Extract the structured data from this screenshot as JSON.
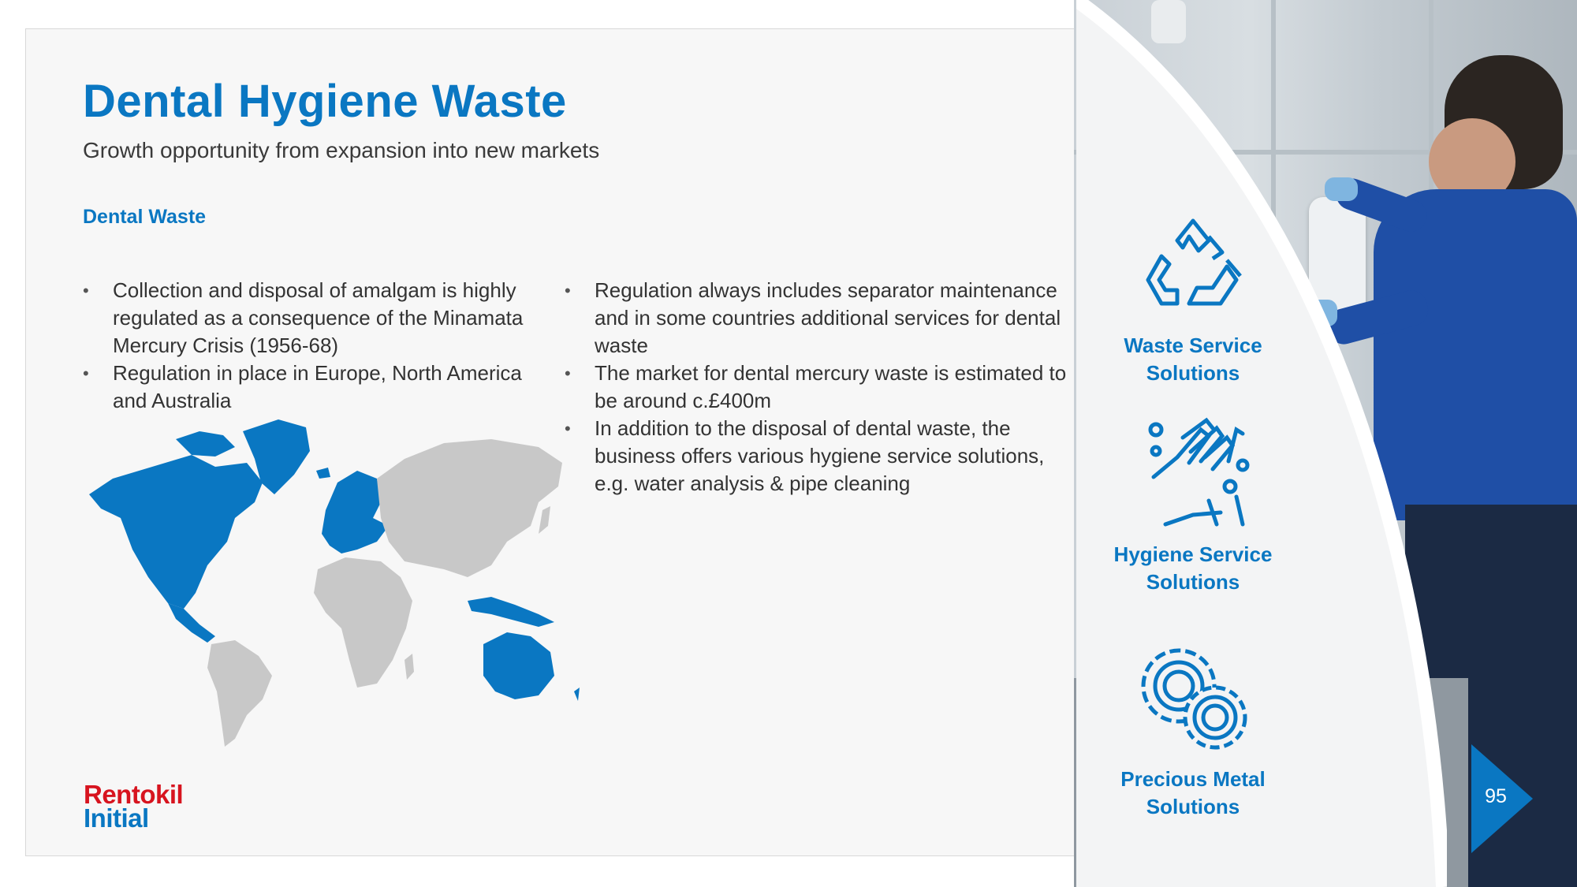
{
  "slide": {
    "title": "Dental Hygiene Waste",
    "subtitle": "Growth opportunity from expansion into new markets",
    "section_heading": "Dental Waste",
    "left_bullets": [
      "Collection and disposal of amalgam is highly regulated as a consequence of the Minamata Mercury Crisis (1956-68)",
      "Regulation in place in Europe, North America and Australia"
    ],
    "right_bullets": [
      "Regulation always includes separator maintenance and in some countries additional services for dental waste",
      "The market for dental mercury waste is estimated to be around c.£400m",
      "In addition to the disposal of dental waste, the business offers various hygiene service solutions, e.g. water analysis & pipe cleaning"
    ],
    "map": {
      "highlighted_regions": [
        "North America",
        "Greenland",
        "Europe",
        "Australia",
        "Indonesia"
      ],
      "highlight_color": "#0a77c2",
      "base_color": "#cccccc"
    }
  },
  "logo": {
    "line1": "Rentokil",
    "line2": "Initial",
    "line1_color": "#d7141f",
    "line2_color": "#0a77c2"
  },
  "services": [
    {
      "icon": "recycle-icon",
      "label_line1": "Waste Service",
      "label_line2": "Solutions"
    },
    {
      "icon": "hand-washing-icon",
      "label_line1": "Hygiene Service",
      "label_line2": "Solutions"
    },
    {
      "icon": "gears-icon",
      "label_line1": "Precious Metal",
      "label_line2": "Solutions"
    }
  ],
  "page_number": "95",
  "colors": {
    "accent": "#0a77c2",
    "text": "#333333"
  }
}
